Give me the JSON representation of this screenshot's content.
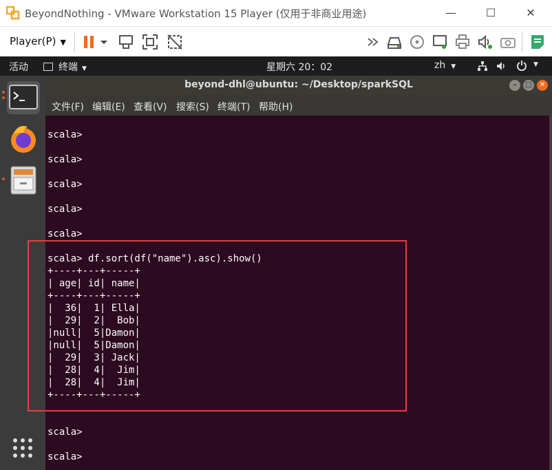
{
  "vmware": {
    "title": "BeyondNothing - VMware Workstation 15 Player (仅用于非商业用途)",
    "player_menu": "Player(P)"
  },
  "ubuntu_topbar": {
    "activities": "活动",
    "app_menu": "终端",
    "clock": "星期六 20：02",
    "input_method": "zh"
  },
  "terminal": {
    "title": "beyond-dhl@ubuntu: ~/Desktop/sparkSQL",
    "menu": [
      "文件(F)",
      "编辑(E)",
      "查看(V)",
      "搜索(S)",
      "终端(T)",
      "帮助(H)"
    ],
    "lines": [
      "scala>",
      "scala>",
      "scala>",
      "scala>",
      "scala>",
      "scala> df.sort(df(\"name\").asc).show()",
      "+----+---+-----+",
      "| age| id| name|",
      "+----+---+-----+",
      "|  36|  1| Ella|",
      "|  29|  2|  Bob|",
      "|null|  5|Damon|",
      "|null|  5|Damon|",
      "|  29|  3| Jack|",
      "|  28|  4|  Jim|",
      "|  28|  4|  Jim|",
      "+----+---+-----+",
      "scala>",
      "scala>"
    ]
  },
  "colors": {
    "terminal_bg": "#2c0a1f",
    "highlight": "#e04141",
    "ubuntu_orange": "#e95420"
  }
}
